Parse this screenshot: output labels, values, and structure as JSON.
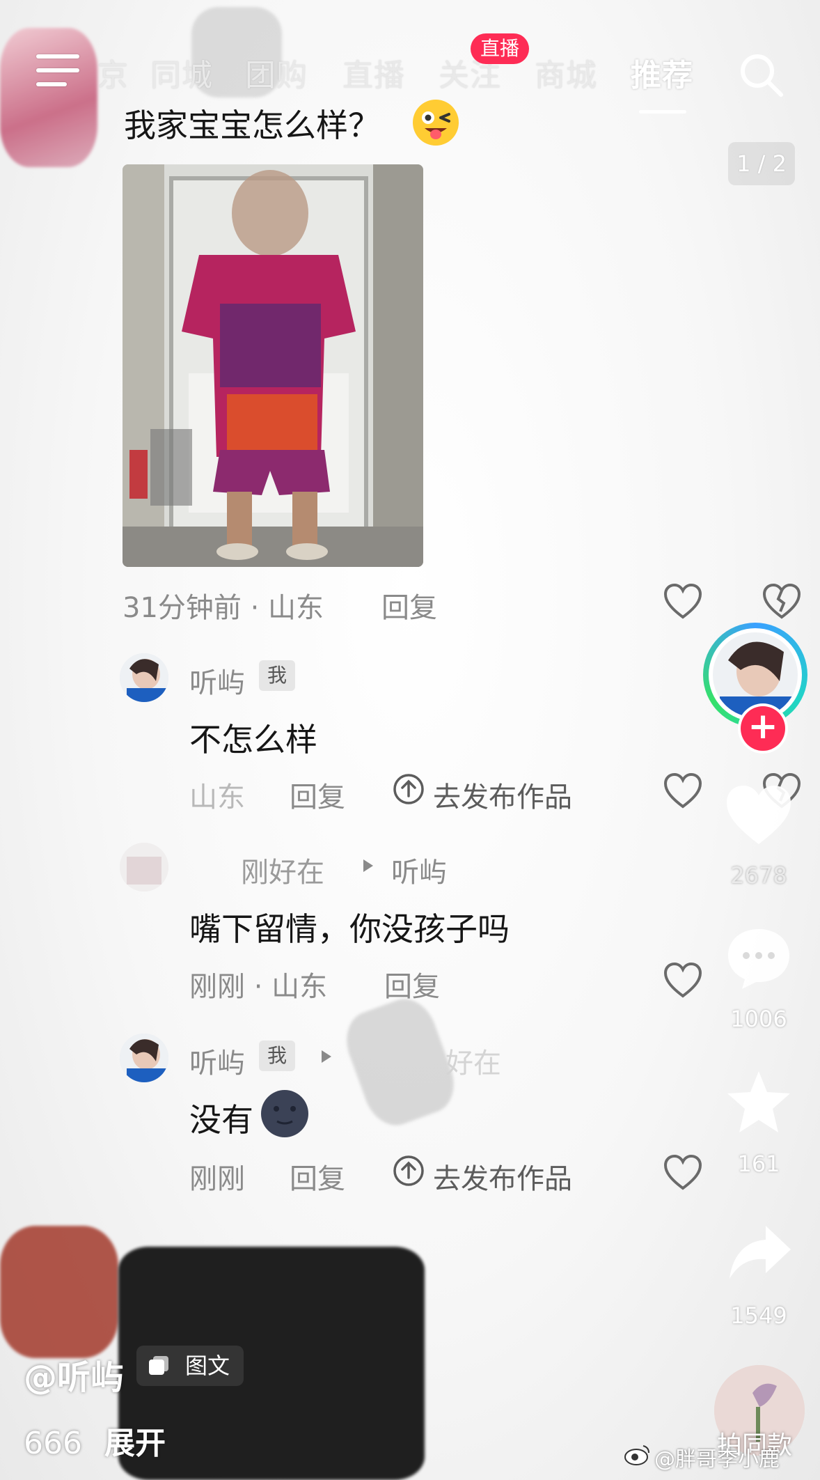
{
  "nav": {
    "tabs": [
      {
        "label": "京"
      },
      {
        "label": "同城"
      },
      {
        "label": "团购"
      },
      {
        "label": "直播"
      },
      {
        "label": "关注"
      },
      {
        "label": "商城"
      },
      {
        "label": "推荐"
      }
    ],
    "active_tab": "推荐",
    "live_badge": "直播",
    "menu_icon": "hamburger-menu-icon",
    "search_icon": "search-icon"
  },
  "pager": {
    "text": "1 / 2"
  },
  "post": {
    "title": "我家宝宝怎么样？",
    "title_emoji": "wink-tongue-emoji",
    "meta_time": "31分钟前 · 山东",
    "meta_reply": "回复"
  },
  "comments": [
    {
      "user": "听屿",
      "tag": "我",
      "text": "不怎么样",
      "meta_loc": "山东",
      "reply": "回复",
      "publish": "去发布作品"
    },
    {
      "user": "刚好在",
      "reply_to": "听屿",
      "text": "嘴下留情，你没孩子吗",
      "meta_time": "刚刚 · 山东",
      "reply": "回复"
    },
    {
      "user": "听屿",
      "tag": "我",
      "reply_to_obscured": "好在",
      "text": "没有",
      "meta_time": "刚刚",
      "reply": "回复",
      "publish": "去发布作品"
    }
  ],
  "rail": {
    "likes": "2678",
    "comments": "1006",
    "favorites": "161",
    "shares": "1549",
    "follow_symbol": "+"
  },
  "bottom": {
    "author": "@听屿",
    "type_chip": "图文",
    "count": "666",
    "expand": "展开",
    "same_style": "拍同款",
    "watermark": "@胖哥李小鹿"
  },
  "colors": {
    "accent": "#fe2c55",
    "text_primary": "#161616",
    "text_secondary": "#8a8a8a"
  }
}
